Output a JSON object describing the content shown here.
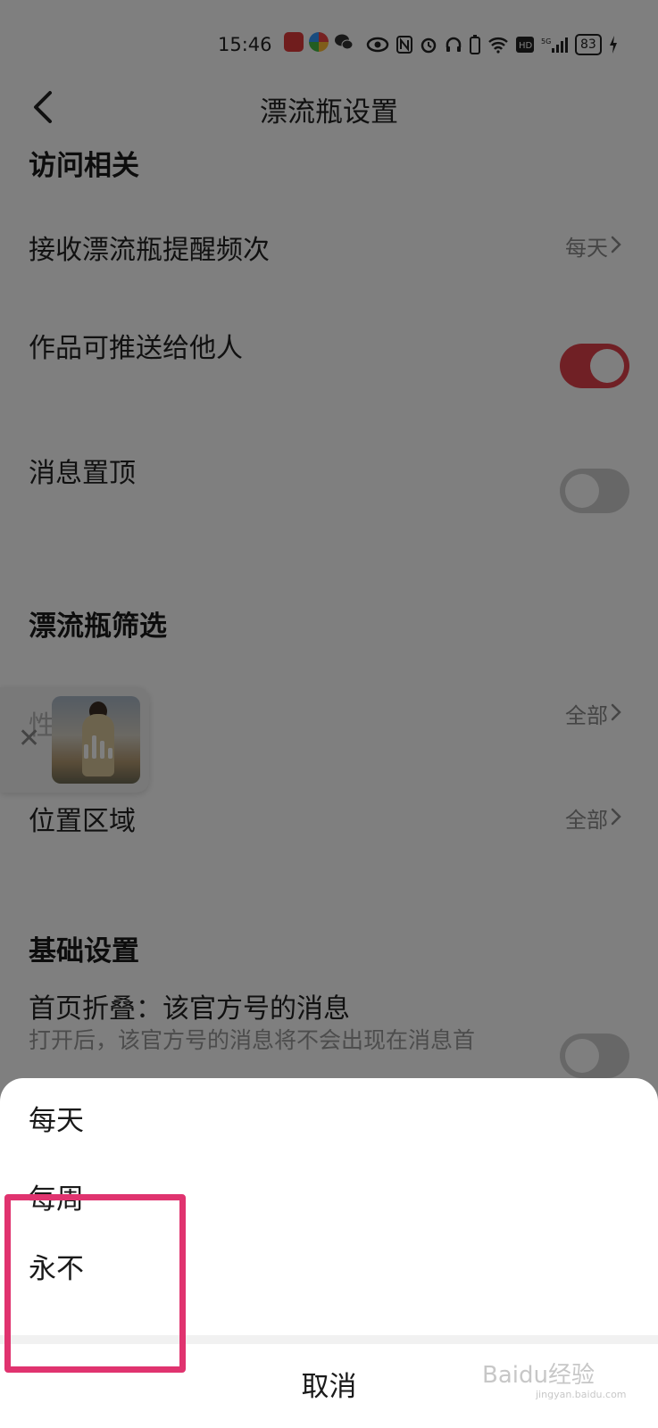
{
  "status_bar": {
    "time": "15:46",
    "battery": "83"
  },
  "header": {
    "title": "漂流瓶设置"
  },
  "sections": {
    "access": {
      "title": "访问相关",
      "reminder_label": "接收漂流瓶提醒频次",
      "reminder_value": "每天",
      "push_label": "作品可推送给他人",
      "push_on": true,
      "pin_label": "消息置顶",
      "pin_on": false
    },
    "filter": {
      "title": "漂流瓶筛选",
      "gender_label": "性",
      "gender_value": "全部",
      "location_label": "位置区域",
      "location_value": "全部"
    },
    "basic": {
      "title": "基础设置",
      "fold_label": "首页折叠：该官方号的消息",
      "fold_sub": "打开后，该官方号的消息将不会出现在消息首"
    }
  },
  "sheet": {
    "options": [
      "每天",
      "每周",
      "永不"
    ],
    "cancel_label": "取消"
  },
  "watermark": {
    "text": "Baidu经验",
    "sub": "jingyan.baidu.com"
  },
  "colors": {
    "toggle_on": "#e0404a",
    "highlight": "#e0336f"
  }
}
